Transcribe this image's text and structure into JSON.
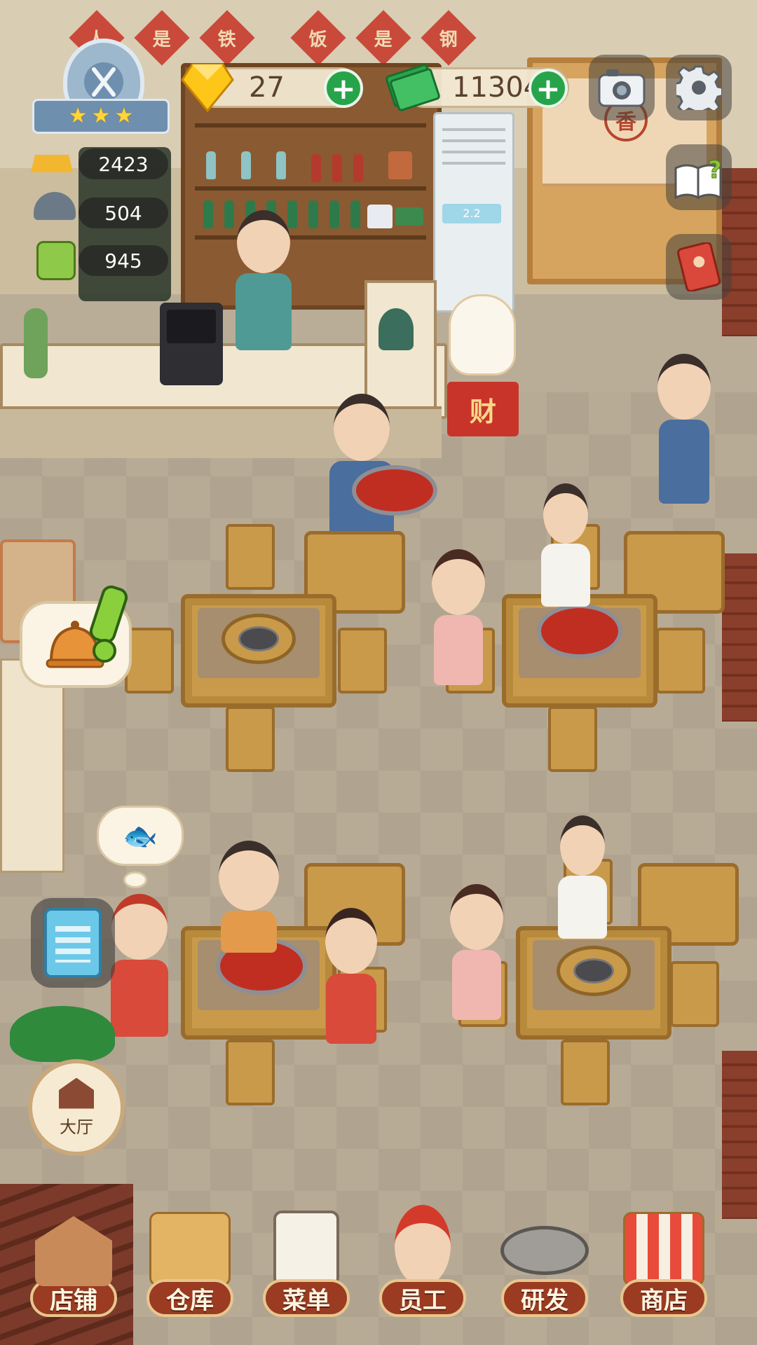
{
  "banner": {
    "chars": [
      "人",
      "是",
      "铁",
      "饭",
      "是",
      "钢"
    ]
  },
  "hud": {
    "stars": 3,
    "diamonds": "27",
    "cash": "11304",
    "stat_gold": "2423",
    "stat_dishes": "504",
    "stat_recipes": "945"
  },
  "decor": {
    "door_sign": "香",
    "fortune_box": "财",
    "aircon_display": "2.2"
  },
  "thought_icon": "🐟",
  "hall_button": {
    "label": "大厅"
  },
  "nav": {
    "items": [
      {
        "label": "店铺"
      },
      {
        "label": "仓库"
      },
      {
        "label": "菜单"
      },
      {
        "label": "员工"
      },
      {
        "label": "研发"
      },
      {
        "label": "商店"
      }
    ]
  },
  "colors": {
    "nav_label_bg": "#9a3b22",
    "plus_green": "#27a44a",
    "hotpot_red": "#c02e22",
    "table_wood": "#c99a4a"
  },
  "icons": [
    "fork-knife-badge-icon",
    "diamond-icon",
    "cash-icon",
    "camera-icon",
    "gear-icon",
    "help-book-icon",
    "red-book-icon",
    "gold-ingot-icon",
    "cloche-icon",
    "recipe-book-icon",
    "bell-icon",
    "exclamation-icon",
    "fish-icon",
    "clipboard-icon",
    "hall-icon"
  ]
}
